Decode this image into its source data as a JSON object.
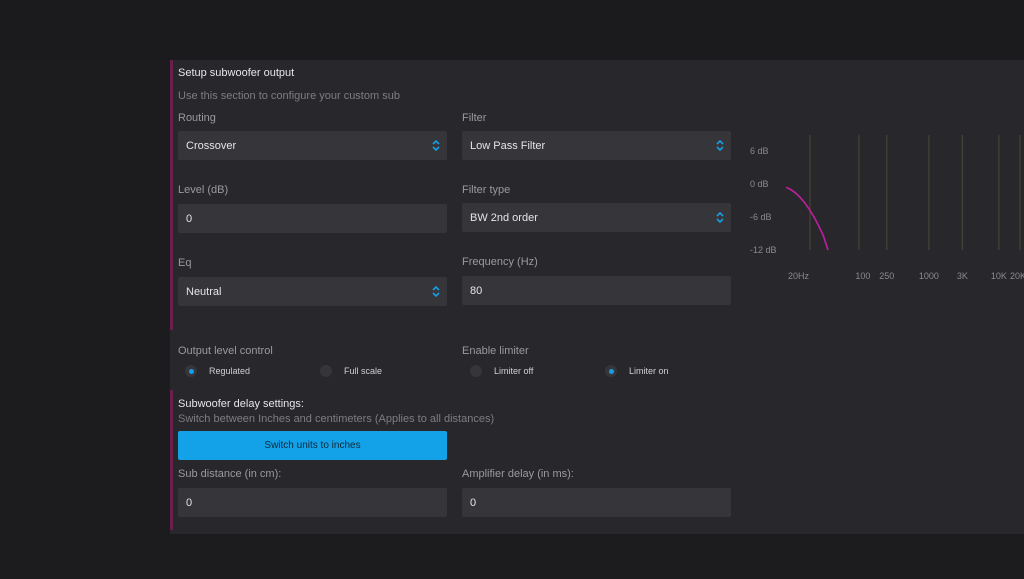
{
  "section": {
    "title": "Setup subwoofer output",
    "subtitle": "Use this section to configure your custom sub"
  },
  "routing": {
    "label": "Routing",
    "value": "Crossover"
  },
  "filter": {
    "label": "Filter",
    "value": "Low Pass Filter"
  },
  "level": {
    "label": "Level (dB)",
    "value": "0"
  },
  "filter_type": {
    "label": "Filter type",
    "value": "BW 2nd order"
  },
  "eq": {
    "label": "Eq",
    "value": "Neutral"
  },
  "frequency": {
    "label": "Frequency (Hz)",
    "value": "80"
  },
  "output_level": {
    "label": "Output level control",
    "options": [
      {
        "label": "Regulated",
        "selected": true
      },
      {
        "label": "Full scale",
        "selected": false
      }
    ]
  },
  "limiter": {
    "label": "Enable limiter",
    "options": [
      {
        "label": "Limiter off",
        "selected": false
      },
      {
        "label": "Limiter on",
        "selected": true
      }
    ]
  },
  "delay": {
    "title": "Subwoofer delay settings:",
    "subtitle": "Switch between Inches and centimeters (Applies to all distances)",
    "switch_button": "Switch units to inches",
    "sub_distance": {
      "label": "Sub distance (in cm):",
      "value": "0"
    },
    "amp_delay": {
      "label": "Amplifier delay (in ms):",
      "value": "0"
    }
  },
  "colors": {
    "accent": "#13a1e7",
    "curve": "#c21ea0",
    "panel": "#28282c"
  },
  "chart_data": {
    "type": "line",
    "y_ticks": [
      "6 dB",
      "0 dB",
      "-6 dB",
      "-12 dB"
    ],
    "y_tick_values": [
      6,
      0,
      -6,
      -12
    ],
    "x_ticks": [
      "20Hz",
      "100",
      "250",
      "1000",
      "3K",
      "10K",
      "20K"
    ],
    "x_tick_values": [
      20,
      100,
      250,
      1000,
      3000,
      10000,
      20000
    ],
    "xscale": "log",
    "ylim": [
      -12,
      6
    ],
    "series": [
      {
        "x": [
          20,
          30,
          40,
          50,
          60,
          70,
          80,
          90,
          100,
          110
        ],
        "y": [
          -0.6,
          -1.0,
          -1.6,
          -2.4,
          -3.4,
          -4.6,
          -6.0,
          -7.6,
          -9.4,
          -12.0
        ]
      }
    ],
    "grid": true
  }
}
